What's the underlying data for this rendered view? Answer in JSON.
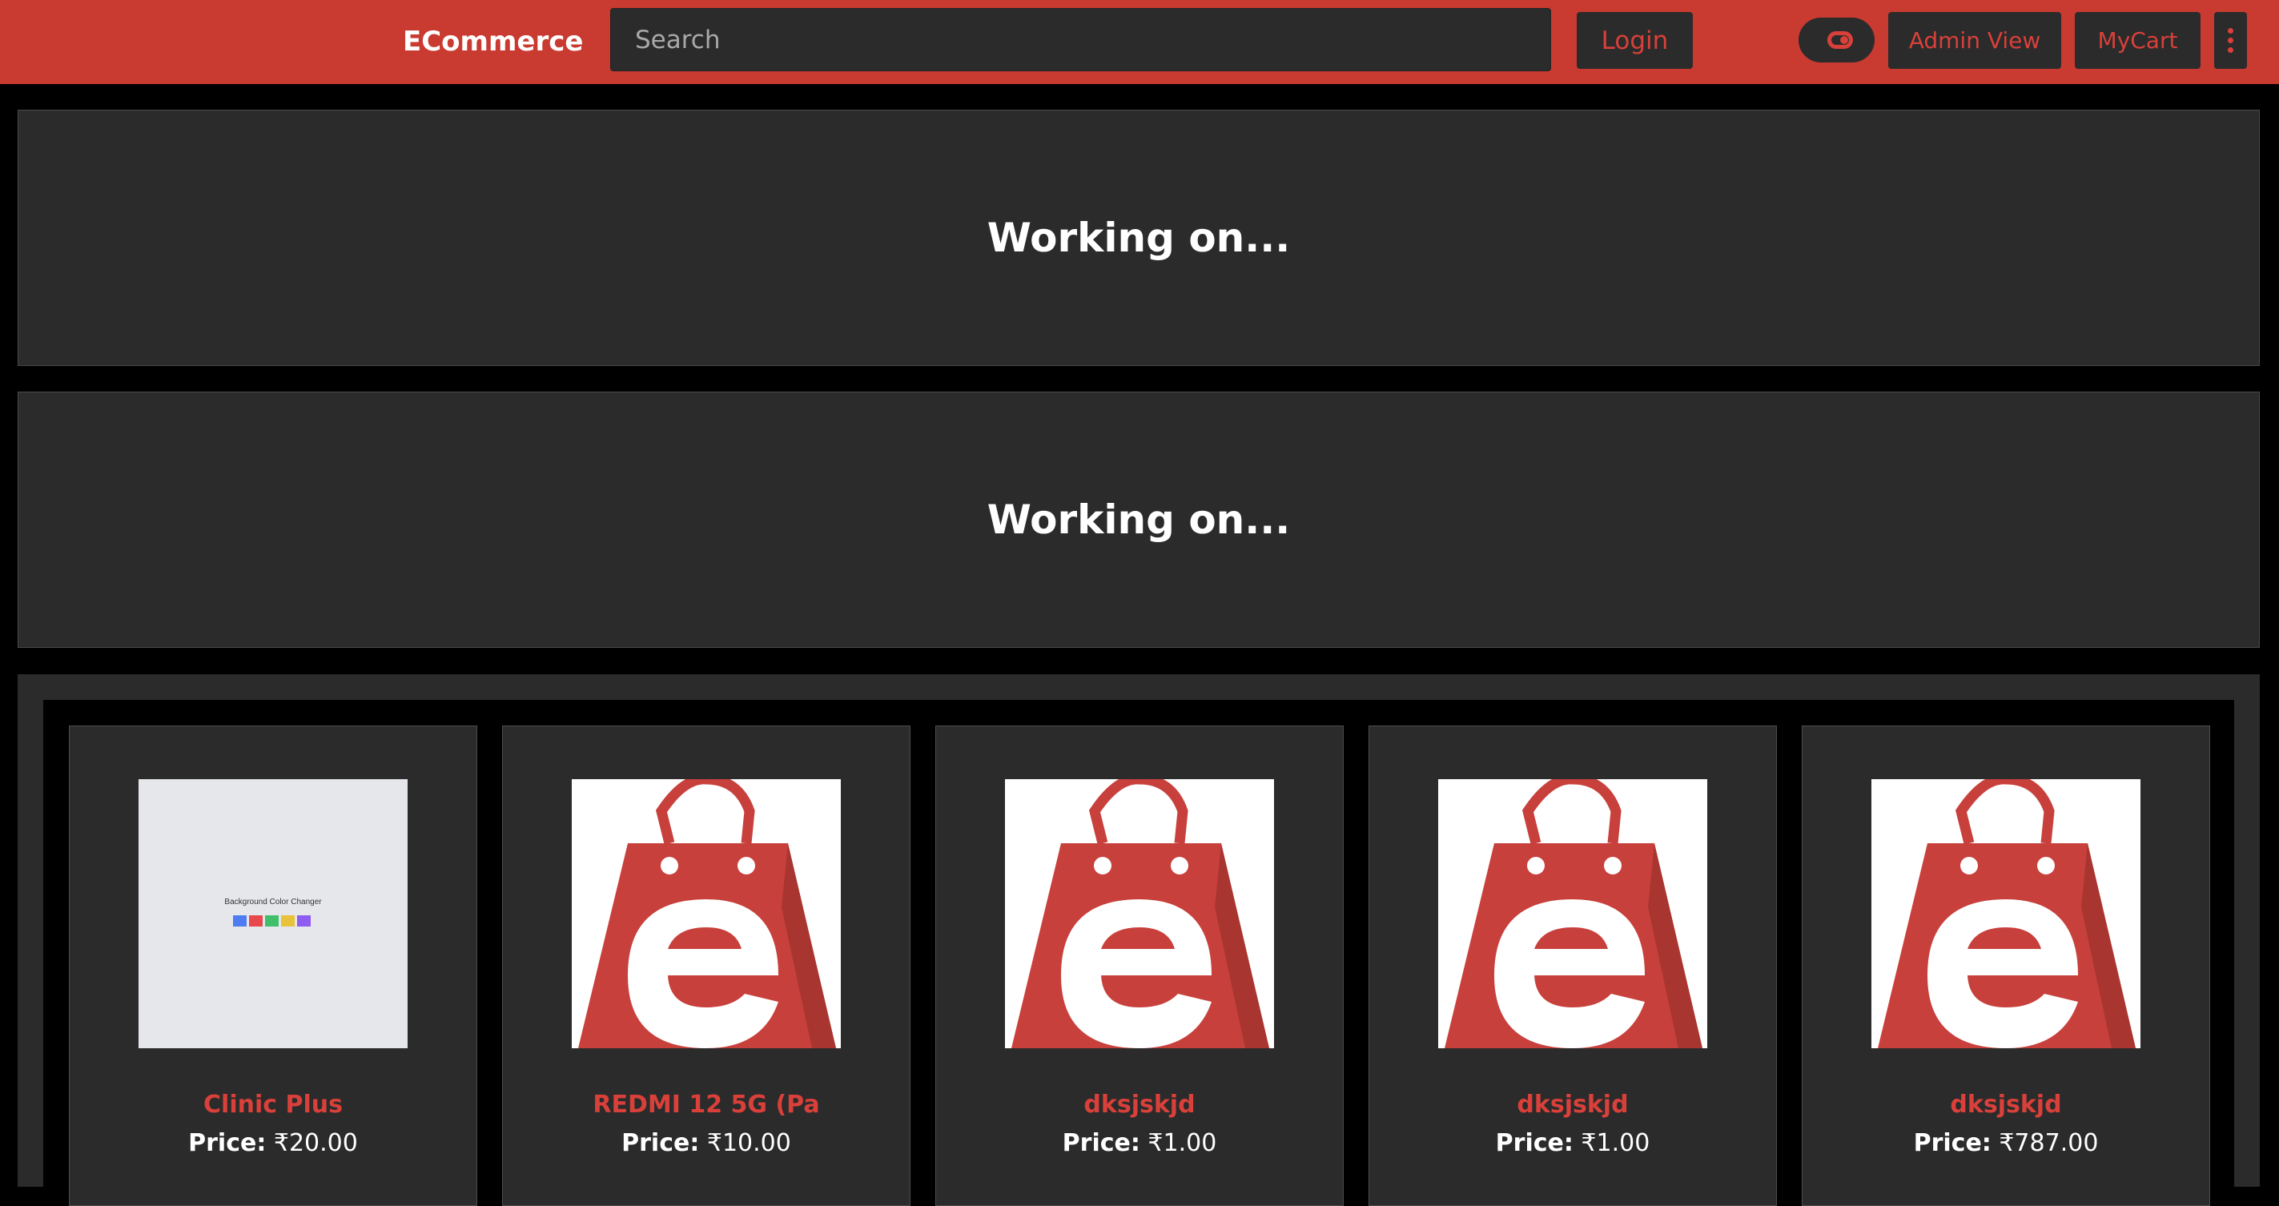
{
  "navbar": {
    "brand": "ECommerce",
    "search_placeholder": "Search",
    "login_label": "Login",
    "admin_label": "Admin View",
    "cart_label": "MyCart",
    "accent_color": "#c93a30"
  },
  "banners": [
    {
      "text": "Working on..."
    },
    {
      "text": "Working on..."
    }
  ],
  "products": [
    {
      "name": "Clinic Plus",
      "price_label": "Price:",
      "price": "₹20.00",
      "image": "background-color-changer-screenshot"
    },
    {
      "name": "REDMI 12 5G (Pa",
      "price_label": "Price:",
      "price": "₹10.00",
      "image": "ecommerce-bag-logo"
    },
    {
      "name": "dksjskjd",
      "price_label": "Price:",
      "price": "₹1.00",
      "image": "ecommerce-bag-logo"
    },
    {
      "name": "dksjskjd",
      "price_label": "Price:",
      "price": "₹1.00",
      "image": "ecommerce-bag-logo"
    },
    {
      "name": "dksjskjd",
      "price_label": "Price:",
      "price": "₹787.00",
      "image": "ecommerce-bag-logo"
    }
  ]
}
